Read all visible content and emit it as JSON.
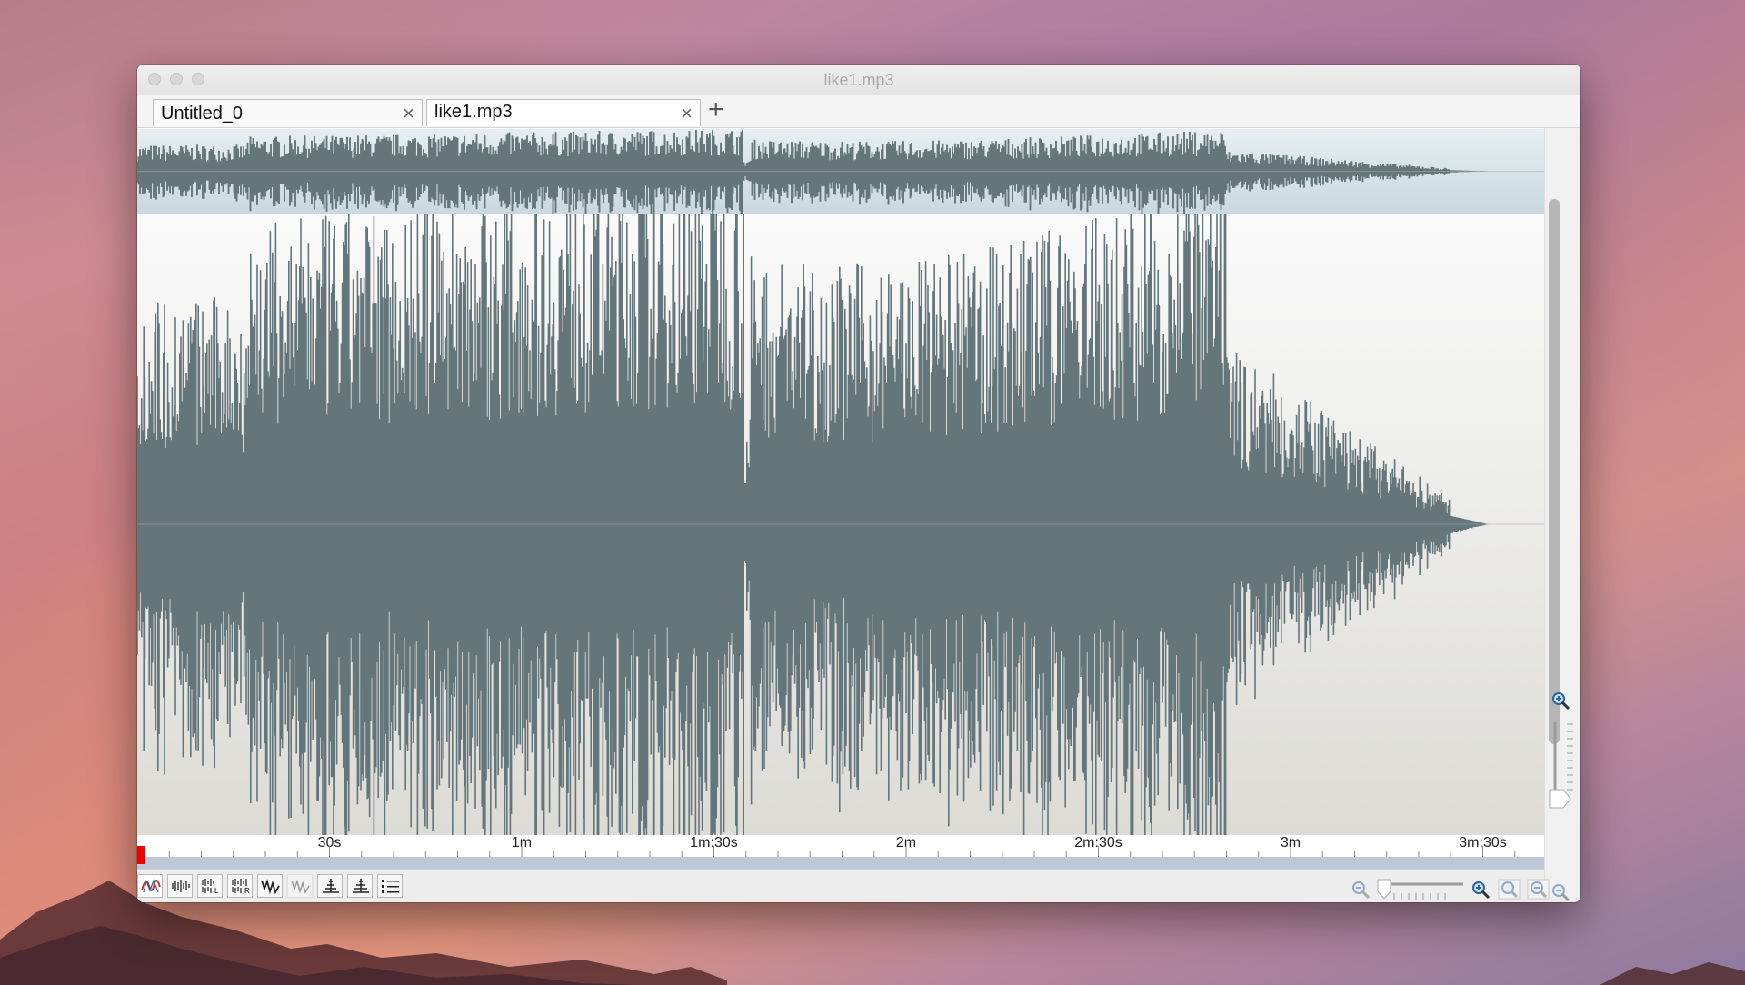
{
  "window": {
    "title": "like1.mp3"
  },
  "tabs": [
    {
      "label": "Untitled_0",
      "active": false
    },
    {
      "label": "like1.mp3",
      "active": true
    }
  ],
  "timeline": {
    "ticks": [
      {
        "label": "30s",
        "seconds": 30
      },
      {
        "label": "1m",
        "seconds": 60
      },
      {
        "label": "1m:30s",
        "seconds": 90
      },
      {
        "label": "2m",
        "seconds": 120
      },
      {
        "label": "2m:30s",
        "seconds": 150
      },
      {
        "label": "3m",
        "seconds": 180
      },
      {
        "label": "3m:30s",
        "seconds": 210
      }
    ]
  },
  "colors": {
    "waveform": "#65767b",
    "overview_bg": "#d3e0e6",
    "playhead": "#e00000",
    "playbar": "#bcc8da"
  },
  "toolbar": {
    "buttons": [
      "waveform-mode-icon",
      "mono-wave-icon",
      "left-channel-icon",
      "right-channel-icon",
      "spectrum-icon",
      "spectrum-alt-icon",
      "levels-icon",
      "levels-alt-icon",
      "list-icon"
    ]
  },
  "zoom": {
    "vertical_icons": [
      "zoom-in-icon",
      "zoom-out-icon",
      "zoom-fit-icon"
    ],
    "horizontal_icons": [
      "zoom-out-icon",
      "zoom-in-icon",
      "zoom-selection-icon",
      "zoom-all-icon"
    ]
  }
}
